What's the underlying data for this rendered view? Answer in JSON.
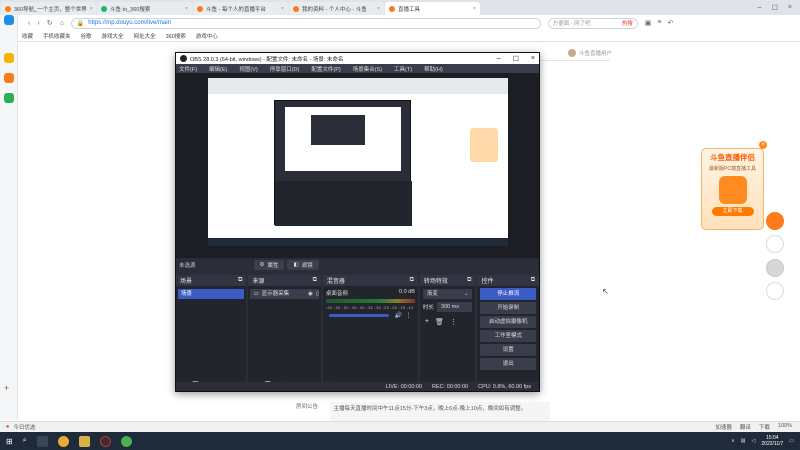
{
  "browser": {
    "tabs": [
      {
        "label": "360导航_一个主页，整个世界"
      },
      {
        "label": "斗鱼 to_360搜索"
      },
      {
        "label": "斗鱼 - 每个人的直播平台"
      },
      {
        "label": "我的资料 - 个人中心 - 斗鱼"
      },
      {
        "label": "直播工具",
        "active": true
      }
    ],
    "url": "https://mp.douyu.com/live/main",
    "search": {
      "placeholder": "方便面 - 网了吧",
      "hot": "热搜"
    },
    "bookmarks": [
      "收藏",
      "手机收藏夹",
      "谷歌",
      "游戏大全",
      "网址大全",
      "360搜索",
      "游戏中心"
    ]
  },
  "page": {
    "user": "斗鱼直播用户",
    "notice_label": "房间公告:",
    "notice_text": "主播每天直播时间中午11点15分-下午3点，晚上6点-晚上10点，晚间如有调整。"
  },
  "ad": {
    "title": "斗鱼直播伴侣",
    "subtitle": "最新版PC端直播工具",
    "button": "立即下载"
  },
  "obs": {
    "title": "OBS 28.0.3 (64-bit, windows) - 配置文件: 未命名 - 场景: 未命名",
    "menu": [
      "文件(F)",
      "编辑(E)",
      "视图(V)",
      "停靠窗口(D)",
      "配置文件(P)",
      "场景集合(S)",
      "工具(T)",
      "帮助(H)"
    ],
    "no_source": "未选源",
    "props_btn": "属性",
    "filter_btn": "滤镜",
    "docks": {
      "scenes": {
        "title": "场景",
        "items": [
          "场景"
        ]
      },
      "sources": {
        "title": "来源",
        "items": [
          "显示器采集"
        ]
      },
      "mixer": {
        "title": "混音器",
        "track": "桌面音频",
        "level": "0.0 dB",
        "scale": "-60 -55 -50 -45 -40 -35 -30 -25 -20 -15 -10 -5 0"
      },
      "transitions": {
        "title": "转场特效",
        "type": "渐变",
        "duration_label": "时长",
        "duration": "300 ms"
      },
      "controls": {
        "title": "控件",
        "buttons": [
          "停止推流",
          "开始录制",
          "启动虚拟摄像机",
          "工作室模式",
          "设置",
          "退出"
        ]
      }
    },
    "status": {
      "live": "LIVE: 00:00:00",
      "rec": "REC: 00:00:00",
      "cpu": "CPU: 0.8%, 60.00 fps"
    }
  },
  "statusbar": {
    "left": "今日优选",
    "right": [
      "加速器",
      "翻译",
      "下载",
      "100%"
    ]
  },
  "taskbar": {
    "time": "15:04",
    "date": "2022/11/7"
  }
}
